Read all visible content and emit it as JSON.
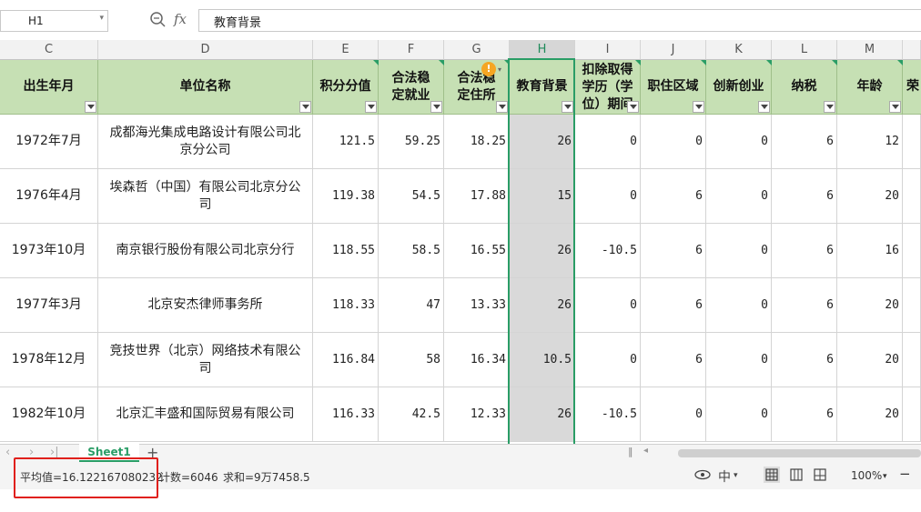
{
  "formula_bar": {
    "name_box": "H1",
    "fx_label": "fx",
    "content": "教育背景"
  },
  "columns": [
    {
      "letter": "C",
      "header": "出生年月"
    },
    {
      "letter": "D",
      "header": "单位名称"
    },
    {
      "letter": "E",
      "header": "积分分值"
    },
    {
      "letter": "F",
      "header": "合法稳定就业"
    },
    {
      "letter": "G",
      "header": "合法稳定住所"
    },
    {
      "letter": "H",
      "header": "教育背景"
    },
    {
      "letter": "I",
      "header": "扣除取得学历（学位）期间"
    },
    {
      "letter": "J",
      "header": "职住区域"
    },
    {
      "letter": "K",
      "header": "创新创业"
    },
    {
      "letter": "L",
      "header": "纳税"
    },
    {
      "letter": "M",
      "header": "年龄"
    },
    {
      "letter": "",
      "header": "荣"
    }
  ],
  "selected_column": "H",
  "rows": [
    [
      "1972年7月",
      "成都海光集成电路设计有限公司北京分公司",
      "121.5",
      "59.25",
      "18.25",
      "26",
      "0",
      "0",
      "0",
      "6",
      "12"
    ],
    [
      "1976年4月",
      "埃森哲（中国）有限公司北京分公司",
      "119.38",
      "54.5",
      "17.88",
      "15",
      "0",
      "6",
      "0",
      "6",
      "20"
    ],
    [
      "1973年10月",
      "南京银行股份有限公司北京分行",
      "118.55",
      "58.5",
      "16.55",
      "26",
      "-10.5",
      "6",
      "0",
      "6",
      "16"
    ],
    [
      "1977年3月",
      "北京安杰律师事务所",
      "118.33",
      "47",
      "13.33",
      "26",
      "0",
      "6",
      "0",
      "6",
      "20"
    ],
    [
      "1978年12月",
      "竞技世界（北京）网络技术有限公司",
      "116.84",
      "58",
      "16.34",
      "10.5",
      "0",
      "6",
      "0",
      "6",
      "20"
    ],
    [
      "1982年10月",
      "北京汇丰盛和国际贸易有限公司",
      "116.33",
      "42.5",
      "12.33",
      "26",
      "-10.5",
      "0",
      "0",
      "6",
      "20"
    ]
  ],
  "sheet_tabs": {
    "active": "Sheet1",
    "add": "+"
  },
  "status_bar": {
    "average": "平均值=16.122167080232",
    "count": "计数=6046",
    "sum": "求和=9万7458.5",
    "input_mode": "中",
    "zoom": "100%",
    "zoom_out": "−"
  },
  "colors": {
    "header_fill": "#c6e0b4",
    "selection": "#2a9d66",
    "highlight_box": "#e0201c"
  }
}
